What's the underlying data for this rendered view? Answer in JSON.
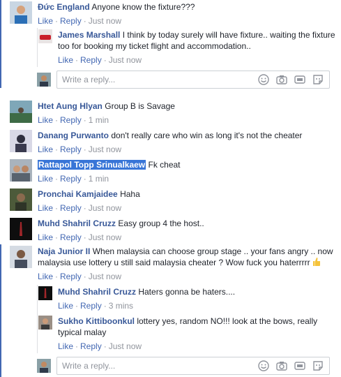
{
  "action_labels": {
    "like": "Like",
    "reply": "Reply",
    "separator": "·"
  },
  "composer": {
    "placeholder": "Write a reply..."
  },
  "threads": [
    {
      "comment": {
        "name": "Đức England",
        "text": "Anyone know the fixture???",
        "time": "Just now"
      },
      "replies": [
        {
          "name": "James Marshall",
          "text": "I think by today surely will have fixture.. waiting the fixture too for booking my ticket flight and accommodation..",
          "time": "Just now"
        }
      ]
    },
    {
      "comment": {
        "name": "Htet Aung Hlyan",
        "text": "Group B is Savage",
        "time": "1 min"
      }
    },
    {
      "comment": {
        "name": "Danang Purwanto",
        "text": "don't really care who win as long it's not the cheater",
        "time": "Just now"
      }
    },
    {
      "comment": {
        "name": "Rattapol Topp Srinualkaew",
        "text": "Fk cheat",
        "time": "1 min"
      }
    },
    {
      "comment": {
        "name": "Pronchai Kamjaidee",
        "text": "Haha",
        "time": "Just now"
      }
    },
    {
      "comment": {
        "name": "Muhd Shahril Cruzz",
        "text": "Easy group 4 the host..",
        "time": "Just now"
      }
    },
    {
      "comment": {
        "name": "Naja Junior II",
        "text": "When malaysia can choose group stage .. your fans angry .. now malaysia use lottery u still said malaysia cheater ? Wow fuck you haterrrrr",
        "time": "Just now"
      },
      "replies": [
        {
          "name": "Muhd Shahril Cruzz",
          "text": "Haters gonna be haters....",
          "time": "3 mins"
        },
        {
          "name": "Sukho Kittiboonkul",
          "text": "lottery yes, random NO!!! look at the bows, really typical malay",
          "time": "Just now"
        }
      ]
    }
  ],
  "colors": {
    "accent": "#4267b2",
    "name": "#385898",
    "meta": "#90949c",
    "selection": "#3875d7"
  }
}
